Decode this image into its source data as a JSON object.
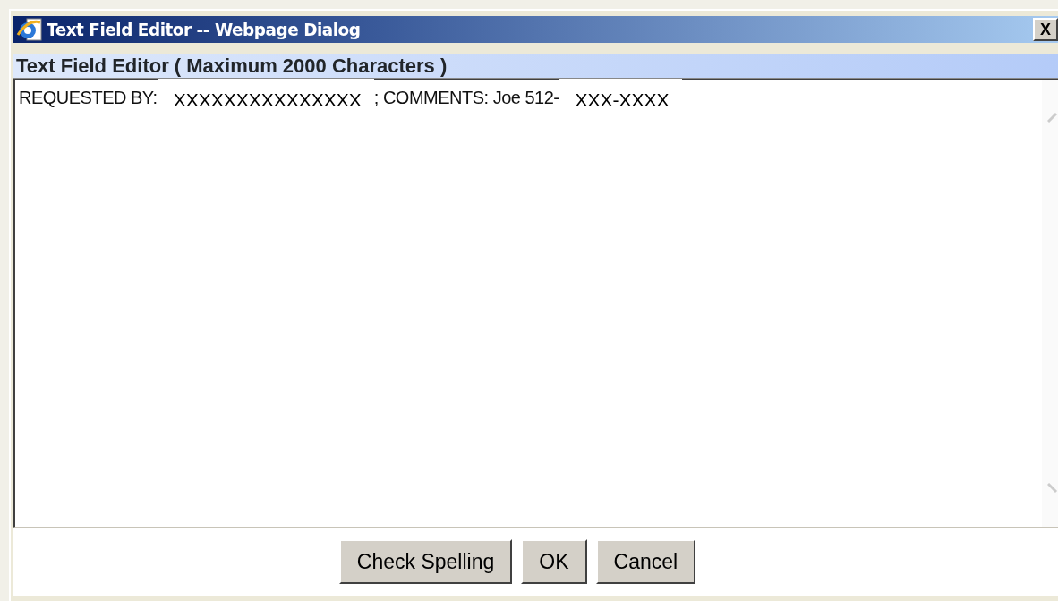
{
  "window": {
    "title": "Text Field Editor -- Webpage Dialog",
    "close": "X"
  },
  "header": "Text Field Editor ( Maximum 2000 Characters )",
  "editor": {
    "segments": [
      {
        "kind": "text",
        "text": "REQUESTED BY:"
      },
      {
        "kind": "redacted",
        "text": "XXXXXXXXXXXXXXX"
      },
      {
        "kind": "text",
        "text": "; COMMENTS: Joe 512-"
      },
      {
        "kind": "redacted",
        "text": "XXX-XXXX"
      }
    ]
  },
  "buttons": [
    "Check Spelling",
    "OK",
    "Cancel"
  ]
}
